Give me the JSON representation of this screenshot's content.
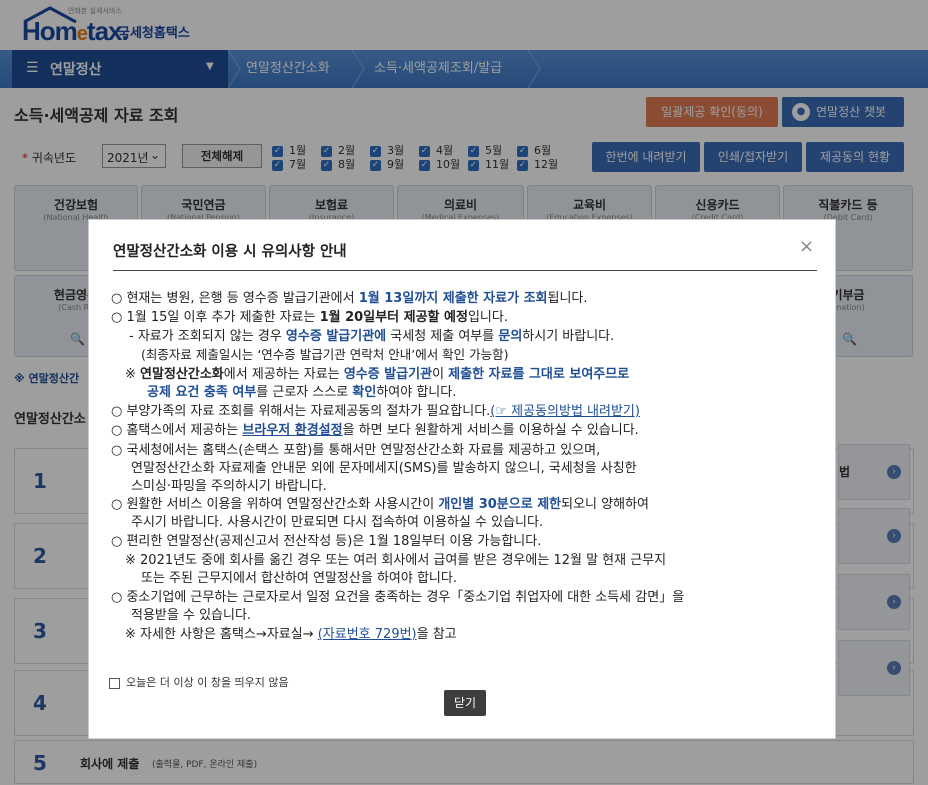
{
  "header": {
    "logo_small": "안화본 실세서비스",
    "logo_word_a": "Hom",
    "logo_word_e": "e",
    "logo_word_b": "tax.",
    "logo_kr": "국세청홈택스"
  },
  "nav": {
    "menu_label": "연말정산",
    "crumbs": [
      "연말정산간소화",
      "소득·세액공제조회/발급"
    ]
  },
  "page": {
    "title": "소득·세액공제 자료 조회",
    "btn_bulk_confirm": "일괄제공 확인(동의)",
    "btn_chatbot": "연말정산 챗봇"
  },
  "filter": {
    "year_label": "귀속년도",
    "year_value": "2021년",
    "unselect_all": "전체해제",
    "months": [
      "1월",
      "2월",
      "3월",
      "4월",
      "5월",
      "6월",
      "7월",
      "8월",
      "9월",
      "10월",
      "11월",
      "12월"
    ],
    "btn_download_once": "한번에 내려받기",
    "btn_print": "인쇄/접자받기",
    "btn_consent": "제공동의 현황"
  },
  "categories_row1": [
    {
      "k": "건강보험",
      "e": "(National Health"
    },
    {
      "k": "국민연금",
      "e": "(National Pension)"
    },
    {
      "k": "보험료",
      "e": "(Insurance)"
    },
    {
      "k": "의료비",
      "e": "(Medical Expenses)"
    },
    {
      "k": "교육비",
      "e": "(Education Expenses)"
    },
    {
      "k": "신용카드",
      "e": "(Credit Card)"
    },
    {
      "k": "직불카드 등",
      "e": "(Debit Card)"
    }
  ],
  "categories_row2": [
    {
      "k": "현금영수",
      "e": "(Cash Re"
    },
    {
      "k": "기부금",
      "e": "onation)"
    }
  ],
  "left": {
    "link": "※ 연말정산간",
    "section_title": "연말정산간소",
    "steps": [
      "1",
      "2",
      "3",
      "4",
      "5"
    ],
    "step5_label": "회사에 제출",
    "step5_sub": "(출력물, PDF, 온라인 제출)",
    "step_right_1": "법"
  },
  "modal": {
    "title": "연말정산간소화 이용 시 유의사항 안내",
    "close_x": "×",
    "l1a": "○ 현재는 병원, 은행 등 영수증 발급기관에서 ",
    "l1b": "1월 13일까지 제출한 자료가 조회",
    "l1c": "됩니다.",
    "l2a": "○ 1월 15일 이후 추가 제출한 자료는 ",
    "l2b": "1월 20일부터 제공할 예정",
    "l2c": "입니다.",
    "l3a": "- 자료가 조회되지 않는 경우 ",
    "l3b": "영수증 발급기관에",
    "l3c": " 국세청 제출 여부를 ",
    "l3d": "문의",
    "l3e": "하시기 바랍니다.",
    "l4": "(최종자료 제출일시는 ‘연수증 발급기관 연락처 안내’에서 확인 가능함)",
    "l5a": "※ ",
    "l5b": "연말정산간소화",
    "l5c": "에서 제공하는 자료는 ",
    "l5d": "영수증 발급기관",
    "l5e": "이 ",
    "l5f": "제출한 자료를 그대로 보여주므로",
    "l6a": "공제 요건 충족 여부",
    "l6b": "를 근로자 스스로 ",
    "l6c": "확인",
    "l6d": "하여야 합니다.",
    "l7a": "○ 부양가족의 자료 조회를 위해서는 자료제공동의 절차가 필요합니다.",
    "l7b": "(☞ 제공동의방법 내려받기)",
    "l8a": "○ 홈택스에서 제공하는 ",
    "l8b": "브라우저 환경설정",
    "l8c": "을 하면 보다 원활하게 서비스를 이용하실 수 있습니다.",
    "l9": "○ 국세청에서는 홈택스(손택스 포함)를 통해서만 연말정산간소화 자료를 제공하고 있으며,",
    "l10": "연말정산간소화 자료제출 안내문 외에 문자메세지(SMS)를 발송하지 않으니, 국세청을 사칭한",
    "l11": "스미싱·파밍을 주의하시기 바랍니다.",
    "l12a": "○ 원활한 서비스 이용을 위하여 연말정산간소화 사용시간이 ",
    "l12b": "개인별 30분으로 제한",
    "l12c": "되오니 양해하여",
    "l13": "주시기 바랍니다. 사용시간이 만료되면 다시 접속하여 이용하실 수 있습니다.",
    "l14": "○ 편리한 연말정산(공제신고서 전산작성 등)은 1월 18일부터 이용 가능합니다.",
    "l15": "※ 2021년도 중에 회사를 옮긴 경우 또는 여러 회사에서 급여를 받은 경우에는 12월 말 현재 근무지",
    "l16": "또는 주된 근무지에서 합산하여 연말정산을 하여야 합니다.",
    "l17": "○ 중소기업에 근무하는 근로자로서 일정 요건을 충족하는 경우「중소기업 취업자에 대한 소득세 감면」을",
    "l18": "적용받을 수 있습니다.",
    "l19a": "※ 자세한 사항은 홈택스→자료실→ ",
    "l19b": "(자료번호 729번)",
    "l19c": "을 참고",
    "dont_show": "오늘은 더 이상 이 창을 띄우지 않음",
    "close_btn": "닫기"
  }
}
